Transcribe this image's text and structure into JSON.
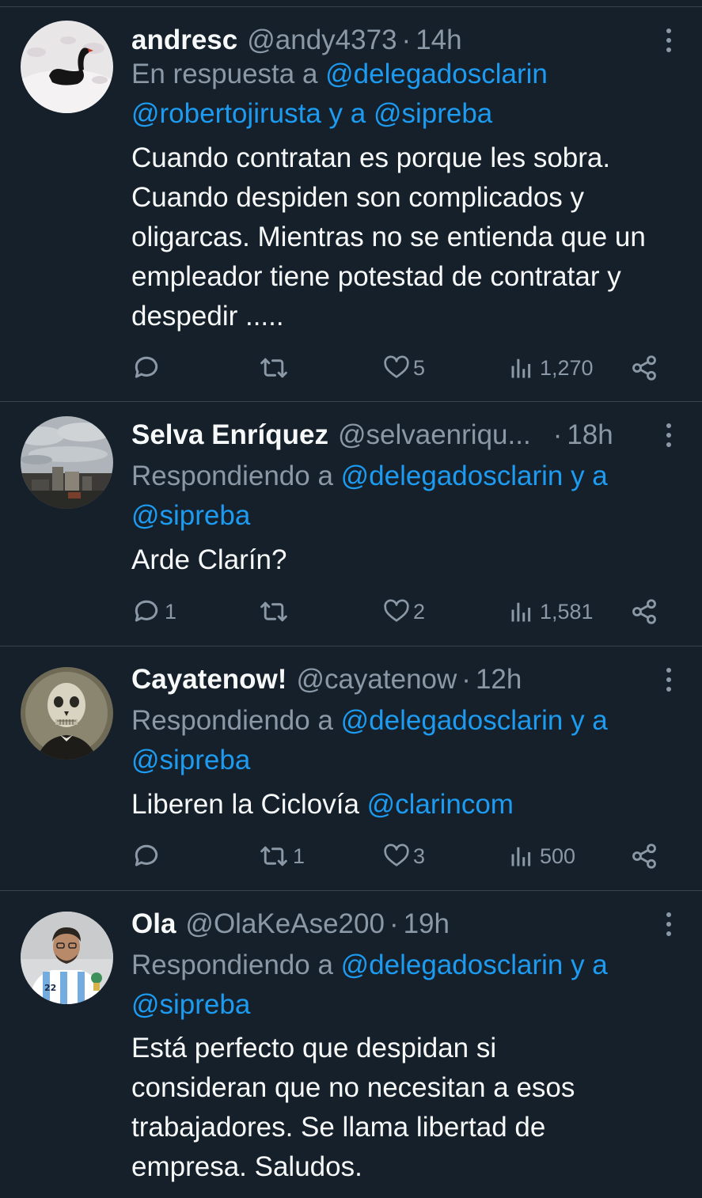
{
  "tweets": [
    {
      "name": "andresc",
      "handle": "@andy4373",
      "separator": "·",
      "time": "14h",
      "reply_prefix": "En respuesta a ",
      "reply_mention_1": "@delegadosclarin",
      "reply_mention_2": "@robertojirusta",
      "reply_join": " y a ",
      "reply_mention_3": "@sipreba",
      "text": "Cuando contratan es porque les sobra. Cuando despiden son complicados y oligarcas. Mientras no se entienda que un empleador tiene potestad de contratar y despedir .....",
      "replies": "",
      "reposts": "",
      "likes": "5",
      "views": "1,270",
      "avatar": "black-swan-avatar"
    },
    {
      "name": "Selva Enríquez",
      "handle": "@selvaenriqu...",
      "separator": "·",
      "time": "18h",
      "reply_prefix": "Respondiendo a ",
      "reply_mention_1": "@delegadosclarin",
      "reply_join": " y a",
      "reply_mention_2": "@sipreba",
      "text": "Arde Clarín?",
      "replies": "1",
      "reposts": "",
      "likes": "2",
      "views": "1,581",
      "avatar": "city-sky-avatar"
    },
    {
      "name": "Cayatenow!",
      "handle": "@cayatenow",
      "separator": "·",
      "time": "12h",
      "reply_prefix": "Respondiendo a ",
      "reply_mention_1": "@delegadosclarin",
      "reply_join": " y a",
      "reply_mention_2": "@sipreba",
      "text": "Liberen la Ciclovía ",
      "text_mention": "@clarincom",
      "replies": "",
      "reposts": "1",
      "likes": "3",
      "views": "500",
      "avatar": "skeleton-avatar"
    },
    {
      "name": "Ola",
      "handle": "@OlaKeAse200",
      "separator": "·",
      "time": "19h",
      "reply_prefix": "Respondiendo a ",
      "reply_mention_1": "@delegadosclarin",
      "reply_join": " y a",
      "reply_mention_2": "@sipreba",
      "text": "Está perfecto que despidan si consideran que no necesitan a esos trabajadores. Se llama libertad de empresa. Saludos.",
      "avatar": "football-shirt-person-avatar"
    }
  ],
  "colors": {
    "background": "#15202b",
    "divider": "#38444d",
    "text": "#f7f9f9",
    "secondary": "#8b98a5",
    "link": "#1d9bf0"
  },
  "icons": [
    "reply-icon",
    "repost-icon",
    "like-icon",
    "views-icon",
    "share-icon",
    "more-icon"
  ]
}
